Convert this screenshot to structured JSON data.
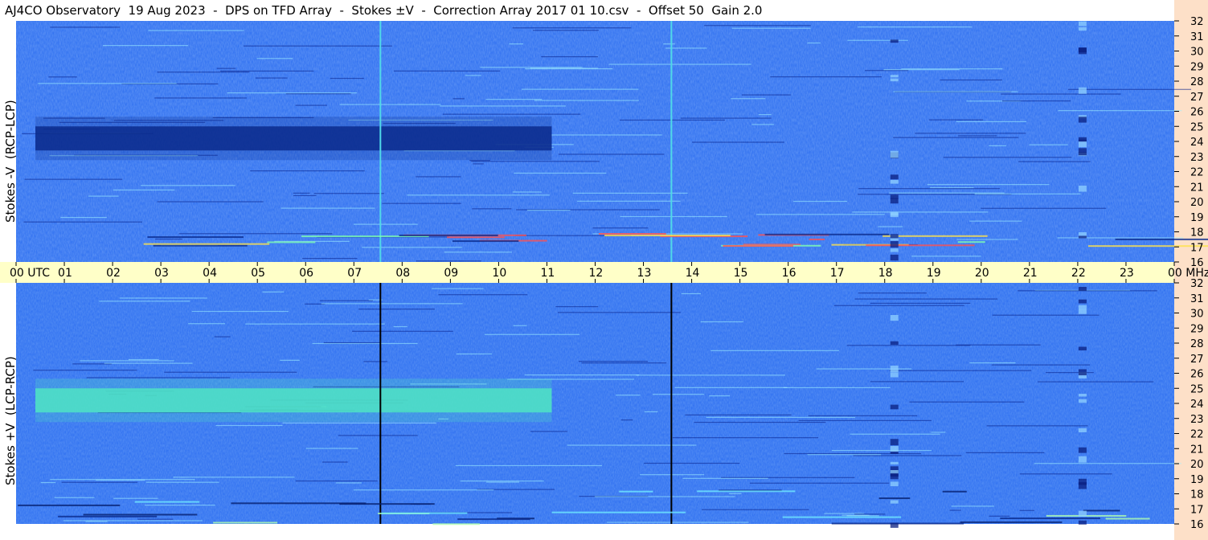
{
  "title": "AJ4CO Observatory  19 Aug 2023  -  DPS on TFD Array  -  Stokes ±V  -  Correction Array 2017 01 10.csv  -  Offset 50  Gain 2.0",
  "colors": {
    "background": "#ffffff",
    "time_axis_band": "#ffffc8",
    "freq_axis_band": "#fde0c8",
    "spectrogram_base": "#2a6cf0",
    "spectrogram_dark": "#0a2a8c",
    "spectrogram_bright": "#4fe4c4"
  },
  "chart_data": [
    {
      "type": "heatmap",
      "ylabel": "Stokes -V  (RCP-LCP)",
      "x_axis": {
        "units": "UTC hours",
        "range": [
          0,
          24
        ],
        "tick_labels": [
          "00",
          "01",
          "02",
          "03",
          "04",
          "05",
          "06",
          "07",
          "08",
          "09",
          "10",
          "11",
          "12",
          "13",
          "14",
          "15",
          "16",
          "17",
          "18",
          "19",
          "20",
          "21",
          "22",
          "23",
          "00"
        ],
        "first_label_suffix": "UTC",
        "last_label_suffix": "MHz"
      },
      "y_axis": {
        "units": "MHz",
        "range": [
          16,
          32
        ],
        "tick_labels": [
          "16",
          "17",
          "18",
          "19",
          "20",
          "21",
          "22",
          "23",
          "24",
          "25",
          "26",
          "27",
          "28",
          "29",
          "30",
          "31",
          "32"
        ]
      },
      "features": [
        {
          "kind": "dark band",
          "time_utc": [
            0.4,
            11.1
          ],
          "freq_mhz": [
            23.4,
            25.0
          ]
        },
        {
          "kind": "bright vertical line",
          "time_utc": 7.55
        },
        {
          "kind": "bright vertical line",
          "time_utc": 13.58
        },
        {
          "kind": "interference band",
          "time_utc": [
            0,
            24
          ],
          "freq_mhz": [
            17.1,
            18.0
          ]
        },
        {
          "kind": "vertical interference",
          "time_utc": 18.2
        },
        {
          "kind": "vertical interference",
          "time_utc": 22.1
        }
      ]
    },
    {
      "type": "heatmap",
      "ylabel": "Stokes +V  (LCP-RCP)",
      "x_axis": {
        "units": "UTC hours",
        "range": [
          0,
          24
        ],
        "tick_labels": [
          "00",
          "01",
          "02",
          "03",
          "04",
          "05",
          "06",
          "07",
          "08",
          "09",
          "10",
          "11",
          "12",
          "13",
          "14",
          "15",
          "16",
          "17",
          "18",
          "19",
          "20",
          "21",
          "22",
          "23",
          "00"
        ]
      },
      "y_axis": {
        "units": "MHz",
        "range": [
          16,
          32
        ],
        "tick_labels": [
          "16",
          "17",
          "18",
          "19",
          "20",
          "21",
          "22",
          "23",
          "24",
          "25",
          "26",
          "27",
          "28",
          "29",
          "30",
          "31",
          "32"
        ]
      },
      "features": [
        {
          "kind": "bright band",
          "time_utc": [
            0.4,
            11.1
          ],
          "freq_mhz": [
            23.4,
            25.0
          ]
        },
        {
          "kind": "dark vertical line",
          "time_utc": 7.55
        },
        {
          "kind": "dark vertical line",
          "time_utc": 13.58
        },
        {
          "kind": "interference band",
          "time_utc": [
            0,
            24
          ],
          "freq_mhz": [
            16.0,
            18.5
          ]
        },
        {
          "kind": "vertical interference",
          "time_utc": 18.2
        },
        {
          "kind": "vertical interference",
          "time_utc": 22.1
        }
      ]
    }
  ]
}
